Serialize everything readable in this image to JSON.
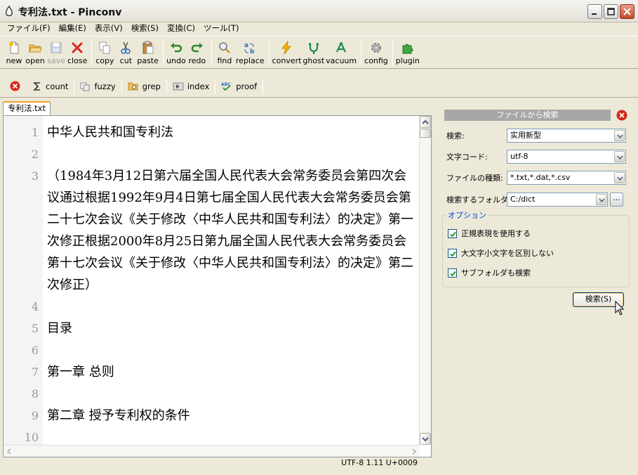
{
  "window": {
    "title": "专利法.txt - Pinconv",
    "controls": [
      "minimize-icon",
      "maximize-icon",
      "close-icon"
    ]
  },
  "menu": [
    "ファイル(F)",
    "編集(E)",
    "表示(V)",
    "検索(S)",
    "変換(C)",
    "ツール(T)"
  ],
  "toolbar": {
    "new": "new",
    "open": "open",
    "save": "save",
    "close": "close",
    "copy": "copy",
    "cut": "cut",
    "paste": "paste",
    "undo": "undo",
    "redo": "redo",
    "find": "find",
    "replace": "replace",
    "convert": "convert",
    "ghost": "ghost",
    "vacuum": "vacuum",
    "config": "config",
    "plugin": "plugin"
  },
  "toolbar2": {
    "count": "count",
    "fuzzy": "fuzzy",
    "grep": "grep",
    "index": "index",
    "proof": "proof"
  },
  "tab": {
    "label": "专利法.txt"
  },
  "editor": {
    "lines": [
      {
        "n": "1",
        "text": "中华人民共和国专利法"
      },
      {
        "n": "2",
        "text": ""
      },
      {
        "n": "3",
        "text": "（1984年3月12日第六届全国人民代表大会常务委员会第四次会议通过根据1992年9月4日第七届全国人民代表大会常务委员会第二十七次会议《关于修改〈中华人民共和国专利法〉的决定》第一次修正根据2000年8月25日第九届全国人民代表大会常务委员会第十七次会议《关于修改〈中华人民共和国专利法〉的决定》第二次修正）"
      },
      {
        "n": "4",
        "text": ""
      },
      {
        "n": "5",
        "text": "目录"
      },
      {
        "n": "6",
        "text": ""
      },
      {
        "n": "7",
        "text": "第一章 总则"
      },
      {
        "n": "8",
        "text": ""
      },
      {
        "n": "9",
        "text": "第二章 授予专利权的条件"
      },
      {
        "n": "10",
        "text": ""
      }
    ]
  },
  "status": {
    "text": "UTF-8  1.11  U+0009"
  },
  "panel": {
    "header": "ファイルから検索",
    "search_label": "検索:",
    "search_value": "实用新型",
    "encoding_label": "文字コード:",
    "encoding_value": "utf-8",
    "filetype_label": "ファイルの種類:",
    "filetype_value": "*.txt,*.dat,*.csv",
    "folder_label": "検索するフォルダ:",
    "folder_value": "C:/dict",
    "browse_label": "...",
    "options_legend": "オプション",
    "opt_regex": "正規表現を使用する",
    "opt_case": "大文字小文字を区別しない",
    "opt_subfolder": "サブフォルダも検索",
    "search_button": "検索(S)"
  }
}
